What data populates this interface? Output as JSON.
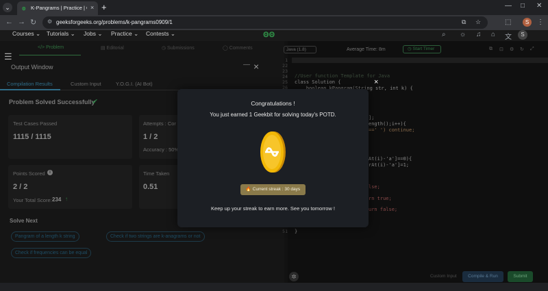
{
  "browser": {
    "tab_title": "K-Pangrams | Practice | GeeksforGeeks",
    "tab_close": "×",
    "tab_menu": "⌄",
    "new_tab": "+",
    "url": "geeksforgeeks.org/problems/k-pangrams0909/1",
    "profile_initial": "S",
    "window_minimize": "—",
    "window_maximize": "□",
    "window_close": "✕"
  },
  "site_nav": {
    "items": [
      "Courses ⌄",
      "Tutorials ⌄",
      "Jobs ⌄",
      "Practice ⌄",
      "Contests ⌄"
    ],
    "logo": "ꙩꙩ",
    "user_initial": "S"
  },
  "problem_tabs": [
    "</> Problem",
    "▤ Editorial",
    "◷ Submissions",
    "◯ Comments"
  ],
  "output_window": {
    "title": "Output Window",
    "minimize": "—",
    "close": "×",
    "tabs": [
      "Compilation Results",
      "Custom Input",
      "Y.O.G.I. (AI Bot)"
    ],
    "status": "Problem Solved Successfully",
    "cards": {
      "test_cases_label": "Test Cases Passed",
      "test_cases_value": "1115 / 1115",
      "attempts_label": "Attempts : Cor",
      "attempts_value": "1 / 2",
      "accuracy_label": "Accuracy : 50%",
      "points_label": "Points Scored",
      "points_value": "2 / 2",
      "total_score_label": "Your Total Score:",
      "total_score_value": "234",
      "time_taken_label": "Time Taken",
      "time_taken_value": "0.51"
    },
    "solve_next_title": "Solve Next",
    "solve_next_items": [
      "Pangram of a length k string",
      "Check if two strings are k-anagrams or not",
      "Check if frequencies can be equal"
    ]
  },
  "editor": {
    "language": "Java (1.8)",
    "average_time": "Average Time: 8m",
    "start_timer": "◷ Start Timer",
    "line_numbers": [
      "1",
      "22",
      "23",
      "24",
      "25",
      "26",
      "51"
    ],
    "code_lines": [
      "//User function Template for Java",
      "class Solution {",
      "    boolean kPangram(String str, int k) {"
    ],
    "code_fragments": [
      "];",
      "ength();i++){",
      "==' ') continue;",
      "At(i)-'a']==0){",
      "rAt(i)-'a']=1;",
      "lse;",
      "rn true;",
      "urn false;",
      "}"
    ],
    "custom_input": "Custom Input",
    "compile_run": "Compile & Run",
    "submit": "Submit"
  },
  "modal": {
    "title": "Congratulations !",
    "message": "You just earned 1 Geekbit for solving today's POTD.",
    "streak": "🔥 Current streak : 30 days",
    "footer": "Keep up your streak to earn more. See you tomorrow !",
    "close": "×"
  },
  "colors": {
    "gfg_green": "#2f8d46",
    "coin_gold": "#f2b807",
    "modal_bg": "#1c1f24"
  }
}
